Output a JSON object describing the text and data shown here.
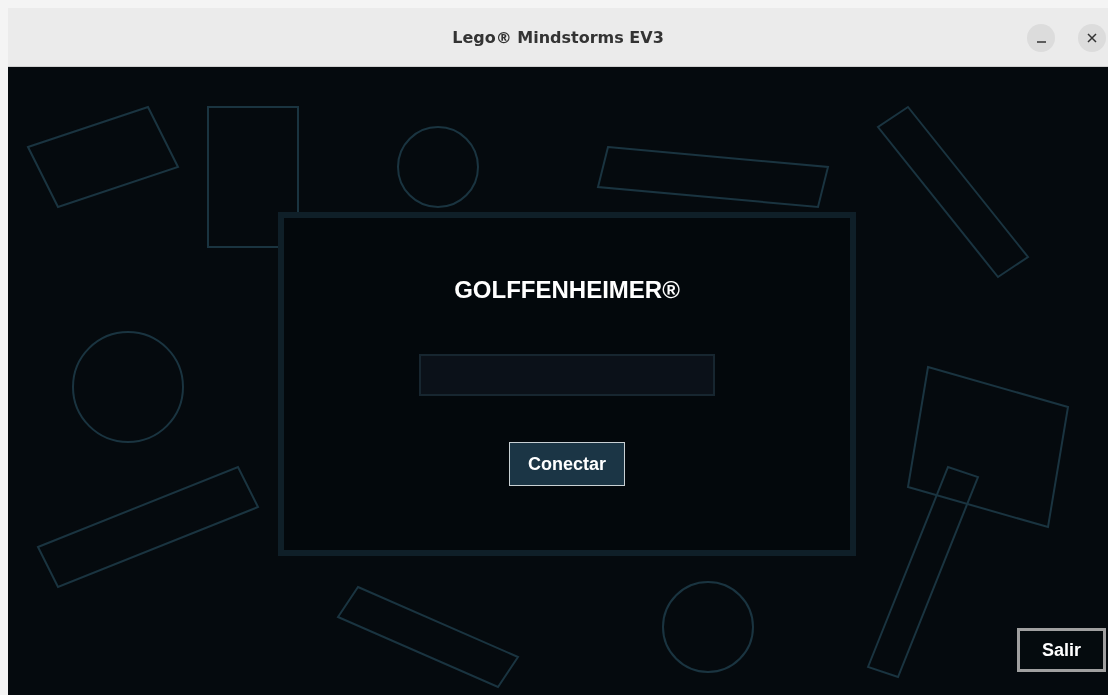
{
  "window": {
    "title": "Lego® Mindstorms EV3"
  },
  "dialog": {
    "title": "GOLFFENHEIMER®",
    "button": "Conectar"
  },
  "exit_button": "Salir"
}
